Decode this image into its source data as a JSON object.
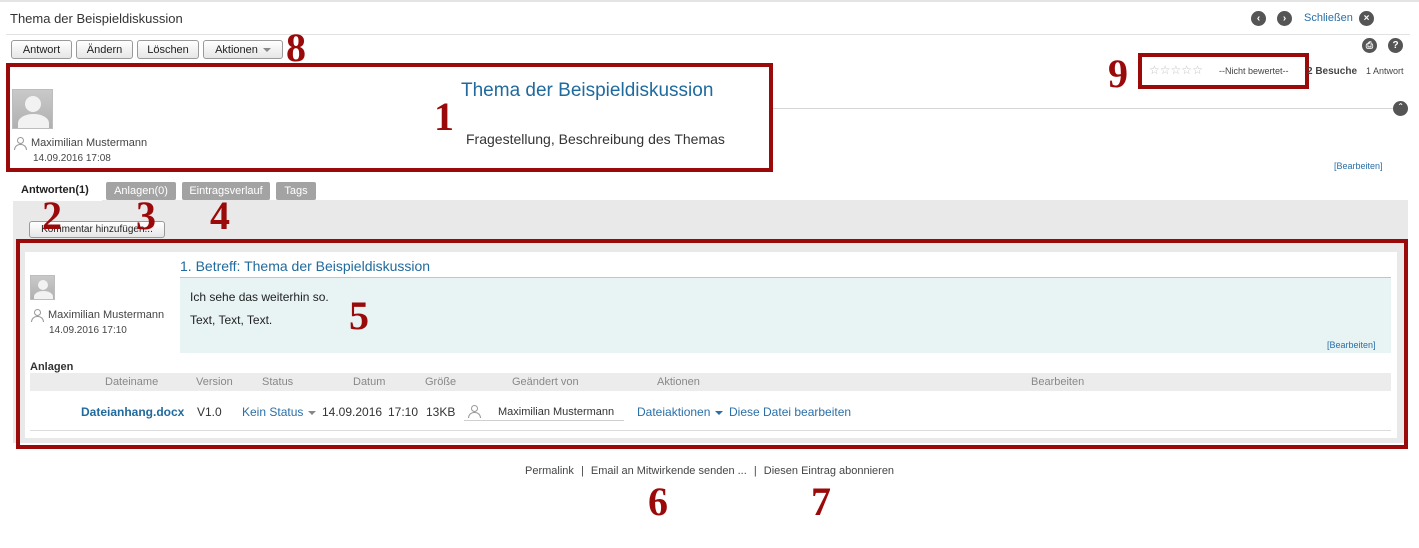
{
  "window": {
    "title": "Thema der Beispieldiskussion",
    "prev_icon": "arrow-left-icon",
    "next_icon": "arrow-right-icon",
    "close_label": "Schließen"
  },
  "toolbar": {
    "reply": "Antwort",
    "edit": "Ändern",
    "delete": "Löschen",
    "actions": "Aktionen"
  },
  "rating": {
    "stars": 0,
    "max_stars": 5,
    "label": "--Nicht bewertet--",
    "visits": "2 Besuche",
    "answers": "1 Antwort"
  },
  "topic": {
    "title": "Thema der Beispieldiskussion",
    "description": "Fragestellung, Beschreibung des Themas",
    "author": "Maximilian Mustermann",
    "date": "14.09.2016 17:08",
    "edit_link": "[Bearbeiten]"
  },
  "tabs": [
    {
      "label": "Antworten(1)"
    },
    {
      "label": "Anlagen(0)"
    },
    {
      "label": "Eintragsverlauf"
    },
    {
      "label": "Tags"
    }
  ],
  "add_comment": "Kommentar hinzufügen...",
  "reply_entry": {
    "title": "1. Betreff: Thema der Beispieldiskussion",
    "line1": "Ich sehe das weiterhin so.",
    "line2": "Text, Text, Text.",
    "author": "Maximilian Mustermann",
    "date": "14.09.2016 17:10",
    "edit_link": "[Bearbeiten]"
  },
  "attachments": {
    "heading": "Anlagen",
    "columns": [
      "Dateiname",
      "Version",
      "Status",
      "Datum",
      "Größe",
      "Geändert von",
      "Aktionen",
      "Bearbeiten"
    ],
    "row": {
      "filename": "Dateianhang.docx",
      "version": "V1.0",
      "status": "Kein Status",
      "date": "14.09.2016",
      "time": "17:10",
      "size": "13KB",
      "changed_by": "Maximilian Mustermann",
      "action": "Dateiaktionen",
      "edit": "Diese Datei bearbeiten"
    }
  },
  "footer": {
    "permalink": "Permalink",
    "sep": "|",
    "email": "Email an Mitwirkende senden ...",
    "subscribe": "Diesen Eintrag abonnieren"
  },
  "annotations": {
    "n1": "1",
    "n2": "2",
    "n3": "3",
    "n4": "4",
    "n5": "5",
    "n6": "6",
    "n7": "7",
    "n8": "8",
    "n9": "9",
    "color": "#9b0a0a"
  },
  "colors": {
    "accent": "#1f6a9e",
    "reply_bg": "#e8f3f4",
    "tab_bg": "#a3a3a3"
  }
}
